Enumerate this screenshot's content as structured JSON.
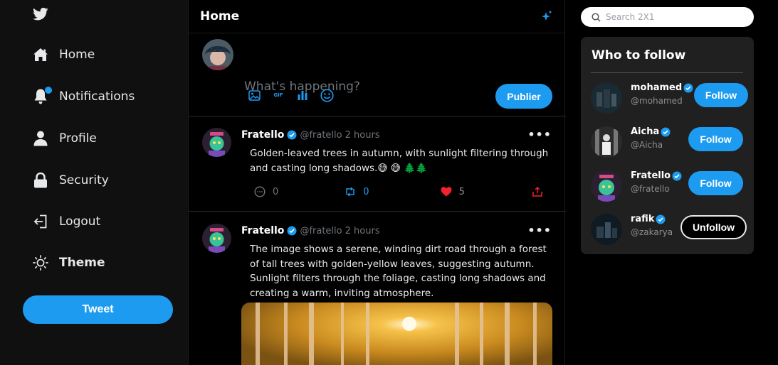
{
  "app": {
    "brand_color": "#1d9bf0",
    "logo": "twitter-bird-icon"
  },
  "sidebar": {
    "items": [
      {
        "label": "Home",
        "icon": "home-icon"
      },
      {
        "label": "Notifications",
        "icon": "bell-icon"
      },
      {
        "label": "Profile",
        "icon": "user-icon"
      },
      {
        "label": "Security",
        "icon": "lock-icon"
      },
      {
        "label": "Logout",
        "icon": "logout-icon"
      },
      {
        "label": "Theme",
        "icon": "sun-icon"
      }
    ],
    "tweet_button": "Tweet"
  },
  "main": {
    "title": "Home",
    "composer": {
      "placeholder": "What's happening?",
      "publish_label": "Publier",
      "tools": [
        "image-icon",
        "gif-icon",
        "poll-icon",
        "emoji-icon"
      ],
      "gif_label": "GIF"
    },
    "posts": [
      {
        "name": "Fratello",
        "handle": "@fratello",
        "time": "2 hours",
        "text": "Golden-leaved trees in autumn, with sunlight filtering through and casting long shadows.😅 😅 🌲🌲",
        "comments": "0",
        "retweets": "0",
        "likes": "5"
      },
      {
        "name": "Fratello",
        "handle": "@fratello",
        "time": "2 hours",
        "text": "The image shows a serene, winding dirt road through a forest of tall trees with golden-yellow leaves, suggesting autumn. Sunlight filters through the foliage, casting long shadows and creating a warm, inviting atmosphere."
      }
    ]
  },
  "search": {
    "placeholder": "Search 2X1"
  },
  "who_to_follow": {
    "title": "Who to follow",
    "users": [
      {
        "name": "mohamed",
        "handle": "@mohamed",
        "action": "Follow"
      },
      {
        "name": "Aicha",
        "handle": "@Aicha",
        "action": "Follow"
      },
      {
        "name": "Fratello",
        "handle": "@fratello",
        "action": "Follow"
      },
      {
        "name": "rafik",
        "handle": "@zakarya",
        "action": "Unfollow"
      }
    ]
  }
}
